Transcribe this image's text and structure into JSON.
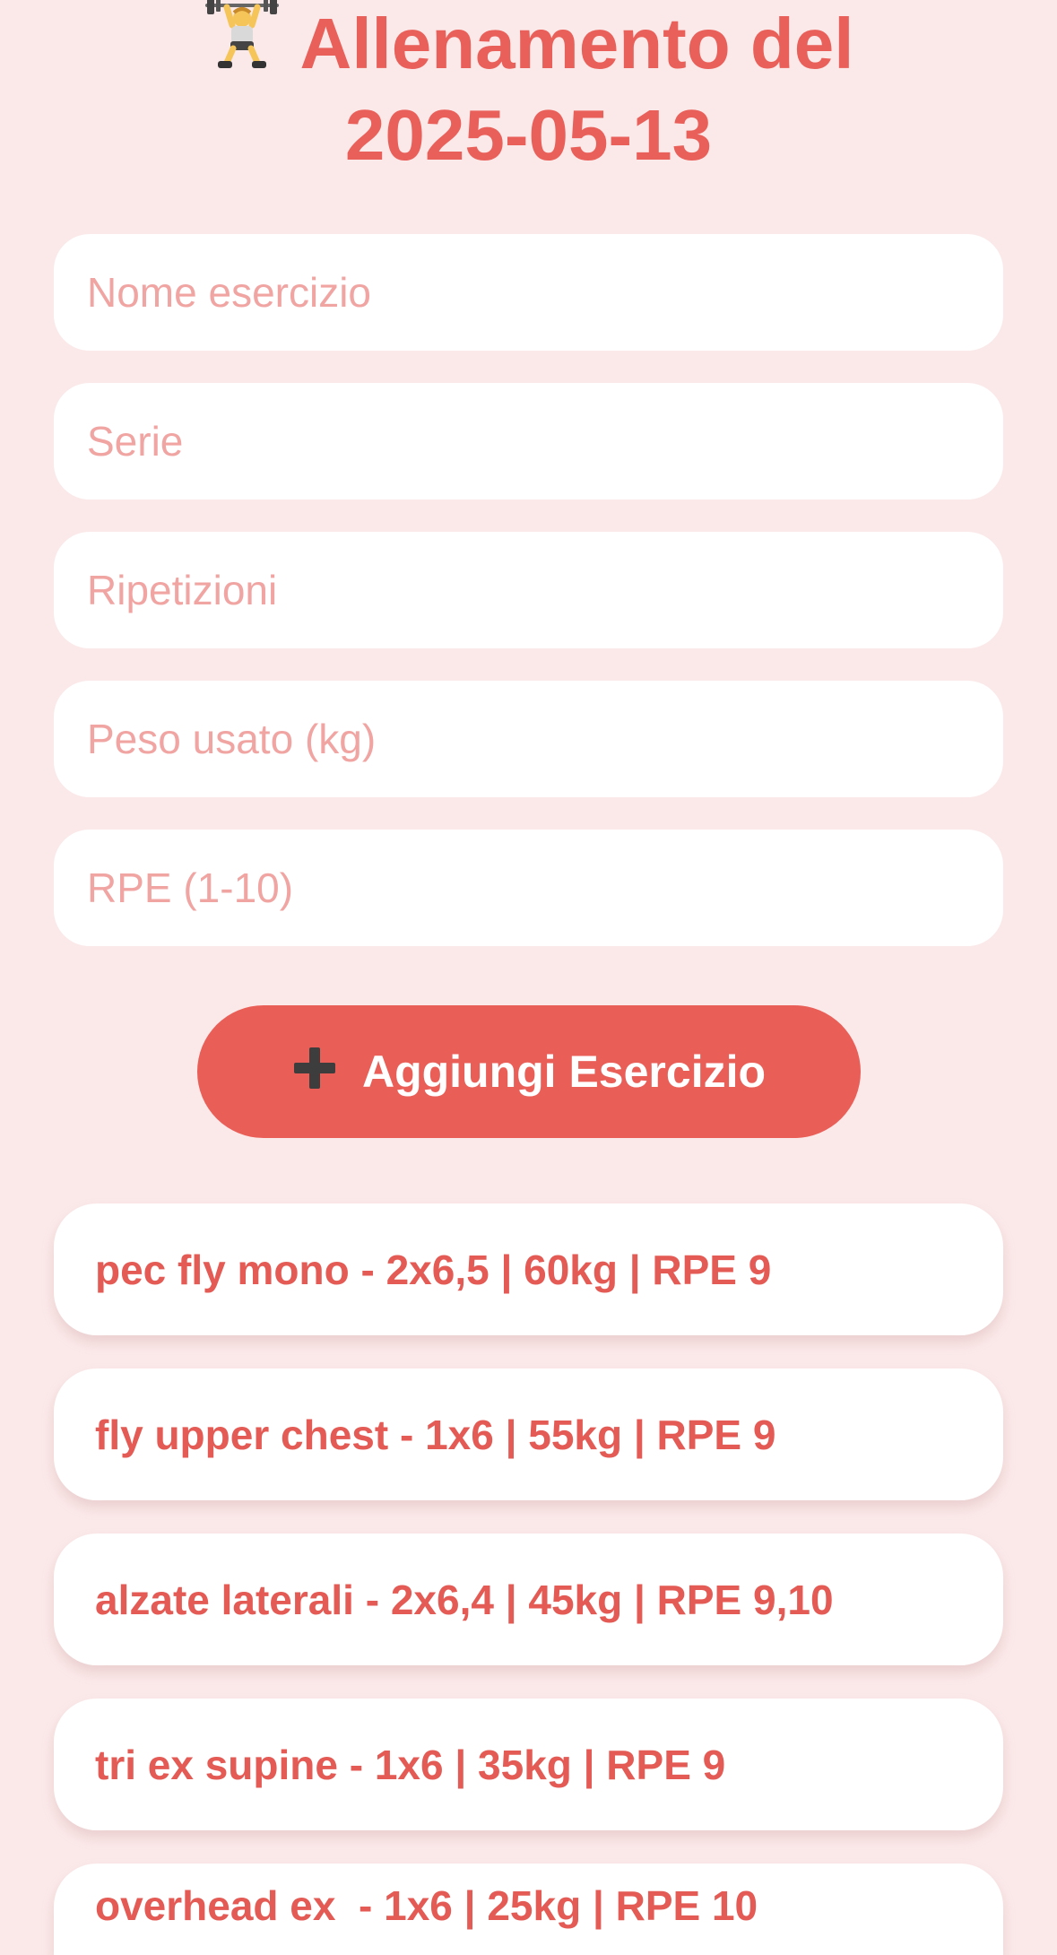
{
  "header": {
    "title_line1": "Allenamento del",
    "title_line2": "2025-05-13",
    "icon": "weightlifter-icon"
  },
  "form": {
    "exercise_name_placeholder": "Nome esercizio",
    "sets_placeholder": "Serie",
    "reps_placeholder": "Ripetizioni",
    "weight_placeholder": "Peso usato (kg)",
    "rpe_placeholder": "RPE (1-10)"
  },
  "add_button": {
    "label": "Aggiungi Esercizio",
    "icon": "plus-icon"
  },
  "exercises": [
    "pec fly mono - 2x6,5 | 60kg | RPE 9",
    "fly upper chest - 1x6 | 55kg | RPE 9",
    "alzate laterali - 2x6,4 | 45kg | RPE 9,10",
    "tri ex supine - 1x6 | 35kg | RPE 9",
    "overhead ex  - 1x6 | 25kg | RPE 10"
  ],
  "colors": {
    "background": "#fbe9e9",
    "accent": "#ea5e58",
    "placeholder": "#f0a5a3",
    "card": "#ffffff"
  }
}
